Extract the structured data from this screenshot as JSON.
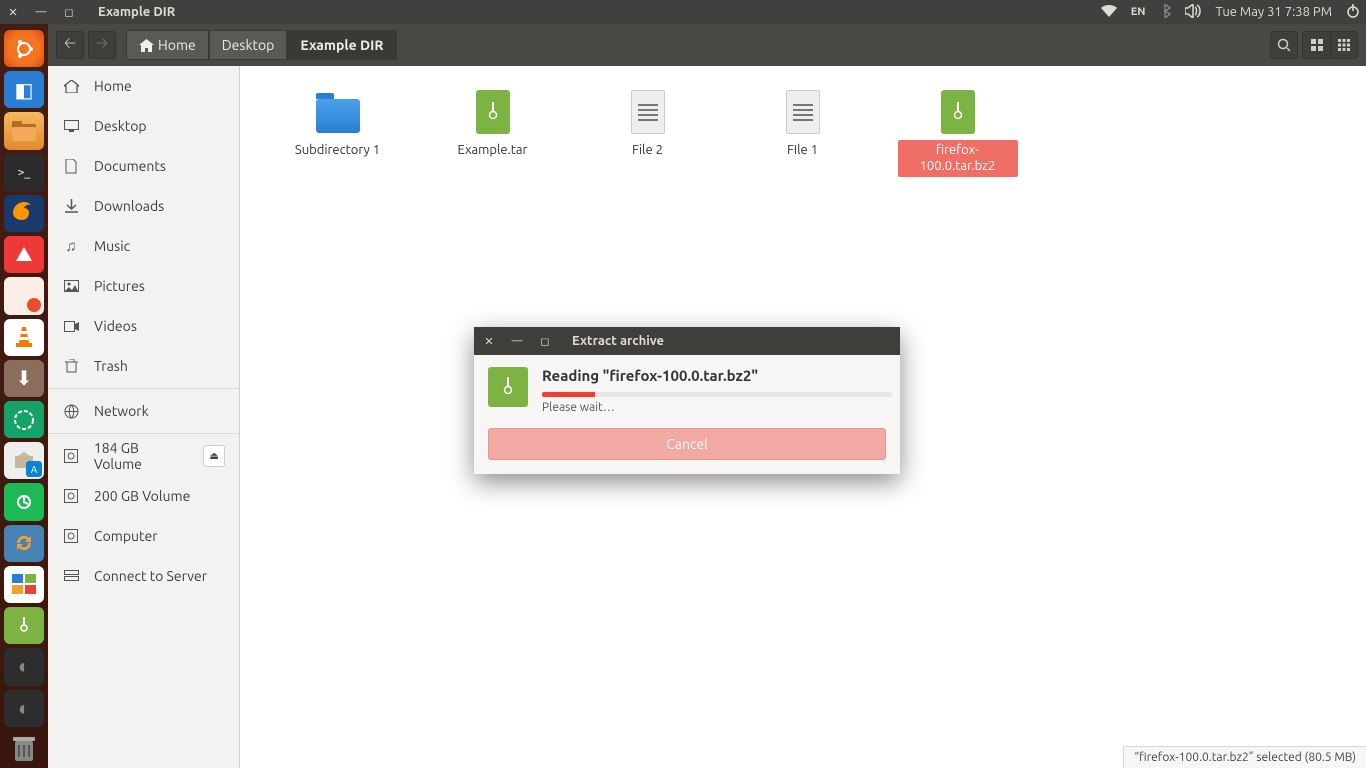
{
  "menubar": {
    "title": "Example DIR",
    "lang": "EN",
    "datetime": "Tue May 31  7:38 PM"
  },
  "toolbar": {
    "breadcrumbs": [
      {
        "label": "Home",
        "icon": "home"
      },
      {
        "label": "Desktop"
      },
      {
        "label": "Example DIR",
        "active": true
      }
    ]
  },
  "sidebar": {
    "places": [
      {
        "icon": "home",
        "label": "Home"
      },
      {
        "icon": "desktop",
        "label": "Desktop"
      },
      {
        "icon": "doc",
        "label": "Documents"
      },
      {
        "icon": "download",
        "label": "Downloads"
      },
      {
        "icon": "music",
        "label": "Music"
      },
      {
        "icon": "pictures",
        "label": "Pictures"
      },
      {
        "icon": "videos",
        "label": "Videos"
      },
      {
        "icon": "trash",
        "label": "Trash"
      }
    ],
    "devices": [
      {
        "icon": "network",
        "label": "Network"
      }
    ],
    "volumes": [
      {
        "icon": "disk",
        "label": "184 GB Volume",
        "eject": true
      },
      {
        "icon": "disk",
        "label": "200 GB Volume"
      },
      {
        "icon": "disk",
        "label": "Computer"
      },
      {
        "icon": "server",
        "label": "Connect to Server"
      }
    ]
  },
  "files": [
    {
      "type": "folder",
      "label": "Subdirectory 1"
    },
    {
      "type": "archive",
      "label": "Example.tar"
    },
    {
      "type": "text",
      "label": "File 2"
    },
    {
      "type": "text",
      "label": "FIle 1"
    },
    {
      "type": "archive",
      "label": "firefox-100.0.tar.bz2",
      "selected": true
    }
  ],
  "statusbar": {
    "text": "“firefox-100.0.tar.bz2” selected  (80.5 MB)"
  },
  "dialog": {
    "title": "Extract archive",
    "heading": "Reading \"firefox-100.0.tar.bz2\"",
    "wait": "Please wait…",
    "cancel": "Cancel"
  }
}
